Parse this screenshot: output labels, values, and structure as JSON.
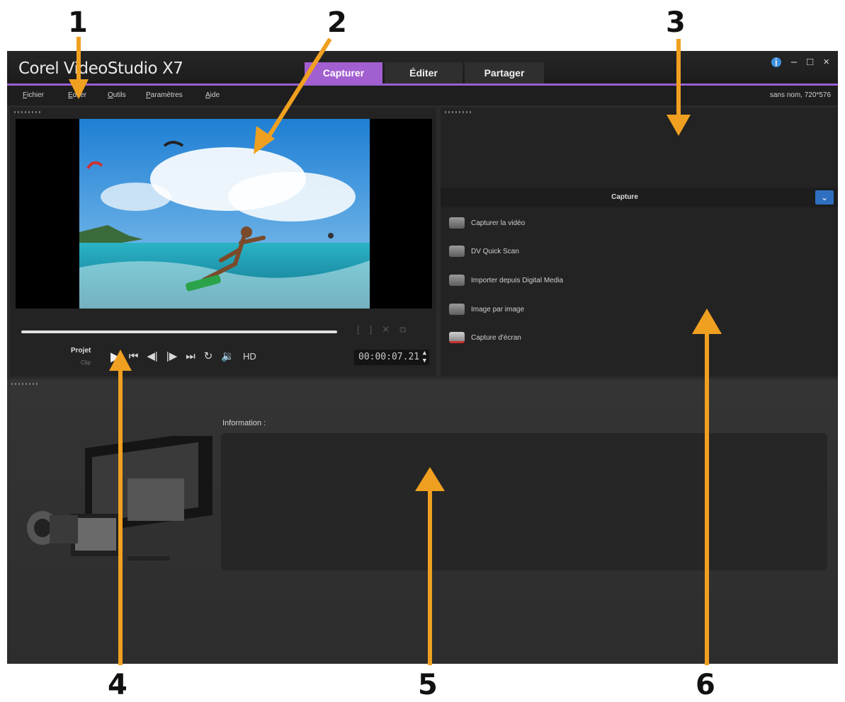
{
  "annotations": {
    "n1": "1",
    "n2": "2",
    "n3": "3",
    "n4": "4",
    "n5": "5",
    "n6": "6"
  },
  "window": {
    "title": "Corel VideoStudio X7",
    "tabs": [
      {
        "label": "Capturer",
        "active": true
      },
      {
        "label": "Éditer",
        "active": false
      },
      {
        "label": "Partager",
        "active": false
      }
    ],
    "controls": {
      "info": "i",
      "minimize": "–",
      "maximize": "□",
      "close": "×"
    }
  },
  "menu": {
    "items": [
      "Fichier",
      "Editer",
      "Outils",
      "Paramètres",
      "Aide"
    ],
    "project_info": "sans nom, 720*576"
  },
  "player": {
    "project_label": "Projet",
    "clip_label": "Clip",
    "timecode": "00:00:07.21",
    "hd_label": "HD",
    "icons": [
      "play-icon",
      "go-to-start-icon",
      "previous-frame-icon",
      "next-frame-icon",
      "go-to-end-icon",
      "repeat-icon",
      "volume-icon"
    ]
  },
  "capture": {
    "title": "Capture",
    "options": [
      {
        "label": "Capturer la vidéo",
        "icon": "video-camera-icon"
      },
      {
        "label": "DV Quick Scan",
        "icon": "dv-camera-icon"
      },
      {
        "label": "Importer depuis Digital Media",
        "icon": "disc-camera-icon"
      },
      {
        "label": "Image par image",
        "icon": "stop-motion-icon"
      },
      {
        "label": "Capture d'écran",
        "icon": "screen-capture-icon"
      }
    ]
  },
  "info_panel": {
    "label": "Information :"
  },
  "colors": {
    "accent": "#a25fd0",
    "arrow": "#f0a020",
    "background": "#2b2b2b"
  }
}
